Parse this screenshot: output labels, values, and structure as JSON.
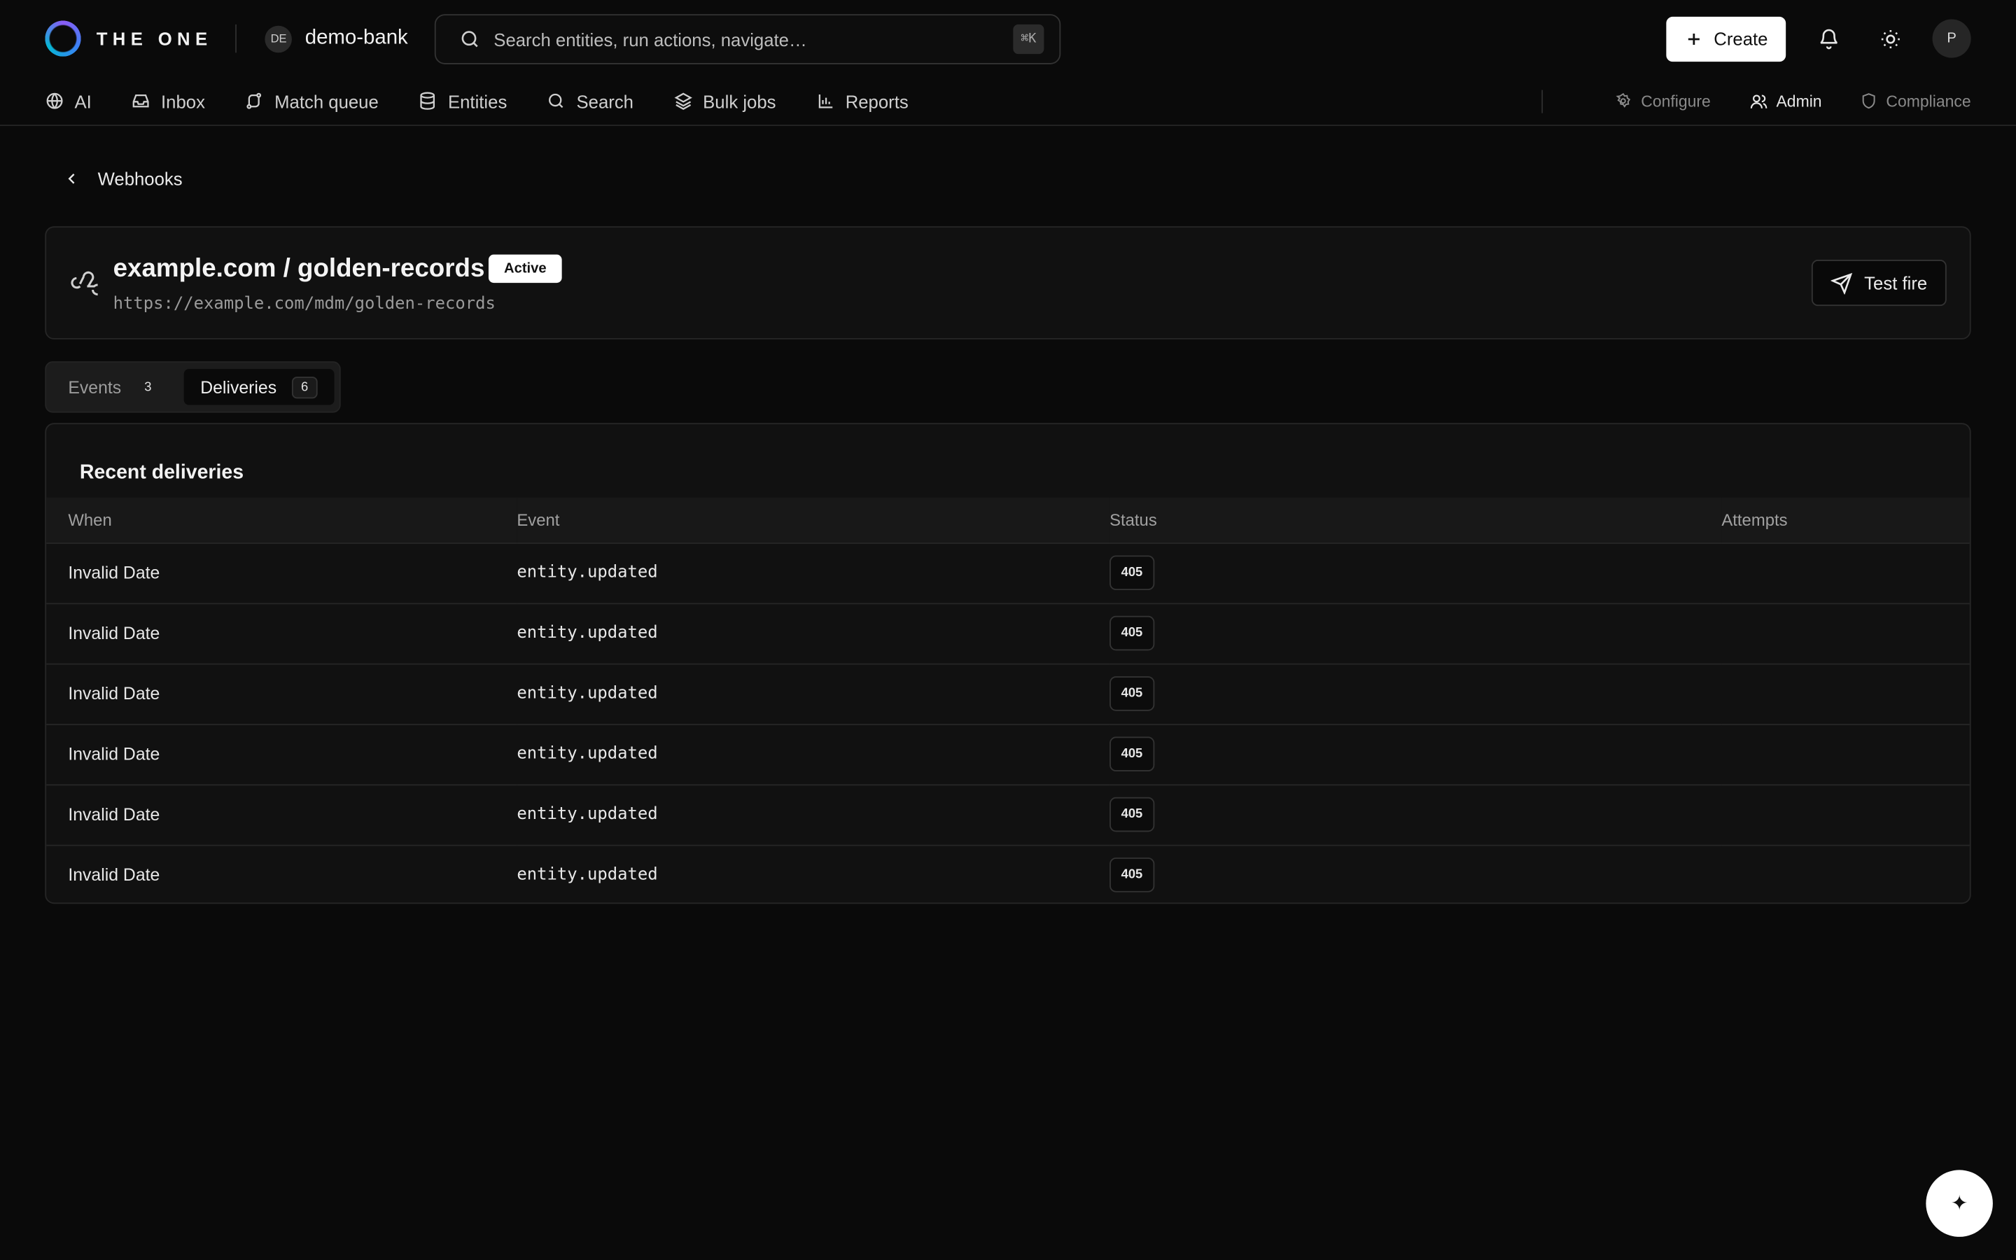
{
  "brand": {
    "name": "THE ONE"
  },
  "tenant": {
    "initials": "DE",
    "name": "demo-bank"
  },
  "search": {
    "placeholder": "Search entities, run actions, navigate…",
    "shortcut": "⌘K"
  },
  "topbar": {
    "create_label": "Create",
    "avatar_initial": "P"
  },
  "nav": {
    "items": [
      {
        "label": "AI",
        "icon": "globe-icon"
      },
      {
        "label": "Inbox",
        "icon": "inbox-icon"
      },
      {
        "label": "Match queue",
        "icon": "route-icon"
      },
      {
        "label": "Entities",
        "icon": "database-icon"
      },
      {
        "label": "Search",
        "icon": "search-icon"
      },
      {
        "label": "Bulk jobs",
        "icon": "layers-icon"
      },
      {
        "label": "Reports",
        "icon": "bar-chart-icon"
      }
    ],
    "right": [
      {
        "label": "Configure",
        "icon": "gear-icon"
      },
      {
        "label": "Admin",
        "icon": "users-icon"
      },
      {
        "label": "Compliance",
        "icon": "shield-icon"
      }
    ]
  },
  "back": {
    "label": "Webhooks"
  },
  "webhook": {
    "title": "example.com / golden-records",
    "status": "Active",
    "url": "https://example.com/mdm/golden-records",
    "test_label": "Test fire"
  },
  "tabs": [
    {
      "label": "Events",
      "count": "3"
    },
    {
      "label": "Deliveries",
      "count": "6"
    }
  ],
  "deliveries": {
    "title": "Recent deliveries",
    "columns": [
      "When",
      "Event",
      "Status",
      "Attempts"
    ],
    "rows": [
      {
        "when": "Invalid Date",
        "event": "entity.updated",
        "status": "405",
        "attempts": ""
      },
      {
        "when": "Invalid Date",
        "event": "entity.updated",
        "status": "405",
        "attempts": ""
      },
      {
        "when": "Invalid Date",
        "event": "entity.updated",
        "status": "405",
        "attempts": ""
      },
      {
        "when": "Invalid Date",
        "event": "entity.updated",
        "status": "405",
        "attempts": ""
      },
      {
        "when": "Invalid Date",
        "event": "entity.updated",
        "status": "405",
        "attempts": ""
      },
      {
        "when": "Invalid Date",
        "event": "entity.updated",
        "status": "405",
        "attempts": ""
      }
    ]
  },
  "fab": {
    "icon": "sparkle-icon",
    "glyph": "✦"
  }
}
